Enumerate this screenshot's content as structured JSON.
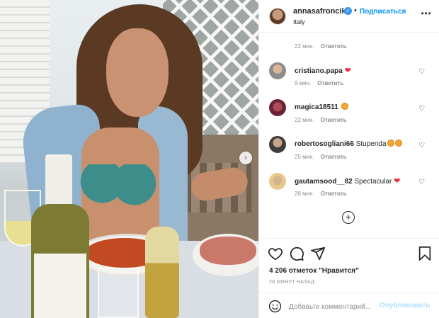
{
  "post": {
    "username": "annasafroncik",
    "follow_label": "Подписаться",
    "dot": "•",
    "location": "Italy",
    "more_icon": "more-dots-icon"
  },
  "comments": {
    "first_meta": {
      "time": "22 мин.",
      "reply": "Ответить"
    },
    "items": [
      {
        "username": "cristiano.papa",
        "text": "",
        "emoji": "heart",
        "time": "9 мин.",
        "reply": "Ответить"
      },
      {
        "username": "magica18511",
        "text": "",
        "emoji": "face",
        "time": "22 мин.",
        "reply": "Ответить"
      },
      {
        "username": "robertosogliani66",
        "text": "Stupenda",
        "emoji": "faces",
        "time": "25 мин.",
        "reply": "Ответить"
      },
      {
        "username": "gautamsood__82",
        "text": "Spectacular",
        "emoji": "heart",
        "time": "26 мин.",
        "reply": "Ответить"
      }
    ],
    "load_more_icon": "plus-circle-icon"
  },
  "actions": {
    "likes_text": "4 206 отметок \"Нравится\"",
    "timestamp": "28 МИНУТ НАЗАД",
    "icons": [
      "heart-icon",
      "comment-icon",
      "share-icon",
      "bookmark-icon"
    ]
  },
  "composer": {
    "placeholder": "Добавьте комментарий...",
    "post_label": "Опубликовать"
  },
  "colors": {
    "link": "#0095f6",
    "muted": "#8e8e8e",
    "heart": "#ed2b3c",
    "post_disabled": "#b2dffc"
  }
}
